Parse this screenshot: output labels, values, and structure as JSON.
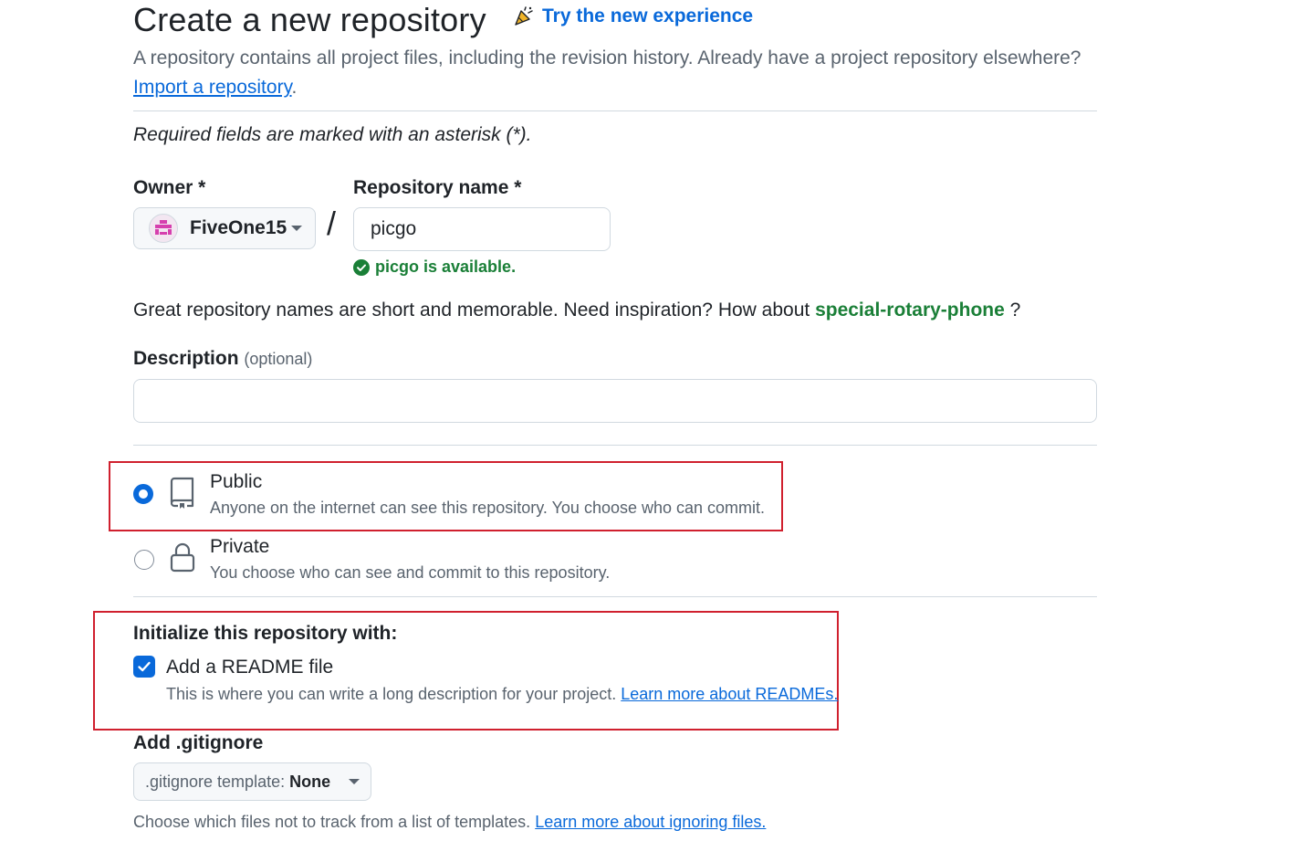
{
  "header": {
    "title": "Create a new repository",
    "try_link": "Try the new experience",
    "intro_text": "A repository contains all project files, including the revision history. Already have a project repository elsewhere?",
    "import_link": "Import a repository",
    "intro_period": "."
  },
  "form": {
    "required_note": "Required fields are marked with an asterisk (*).",
    "owner": {
      "label": "Owner *",
      "value": "FiveOne15"
    },
    "slash": "/",
    "repo_name": {
      "label": "Repository name *",
      "value": "picgo",
      "availability": "picgo is available."
    },
    "suggestion": {
      "text_before": "Great repository names are short and memorable. Need inspiration? How about",
      "name": "special-rotary-phone",
      "text_after": "?"
    },
    "description": {
      "label": "Description",
      "optional": "(optional)",
      "value": ""
    },
    "visibility": {
      "public": {
        "title": "Public",
        "desc": "Anyone on the internet can see this repository. You choose who can commit.",
        "selected": true
      },
      "private": {
        "title": "Private",
        "desc": "You choose who can see and commit to this repository.",
        "selected": false
      }
    },
    "init": {
      "heading": "Initialize this repository with:",
      "readme_label": "Add a README file",
      "readme_checked": true,
      "readme_desc": "This is where you can write a long description for your project.",
      "readme_link": "Learn more about READMEs."
    },
    "gitignore": {
      "label": "Add .gitignore",
      "button_prefix": ".gitignore template:",
      "button_value": "None",
      "help_text": "Choose which files not to track from a list of templates.",
      "help_link": "Learn more about ignoring files."
    }
  },
  "colors": {
    "accent": "#0969da",
    "success": "#1a7f37",
    "highlight_box": "#d0202e"
  }
}
